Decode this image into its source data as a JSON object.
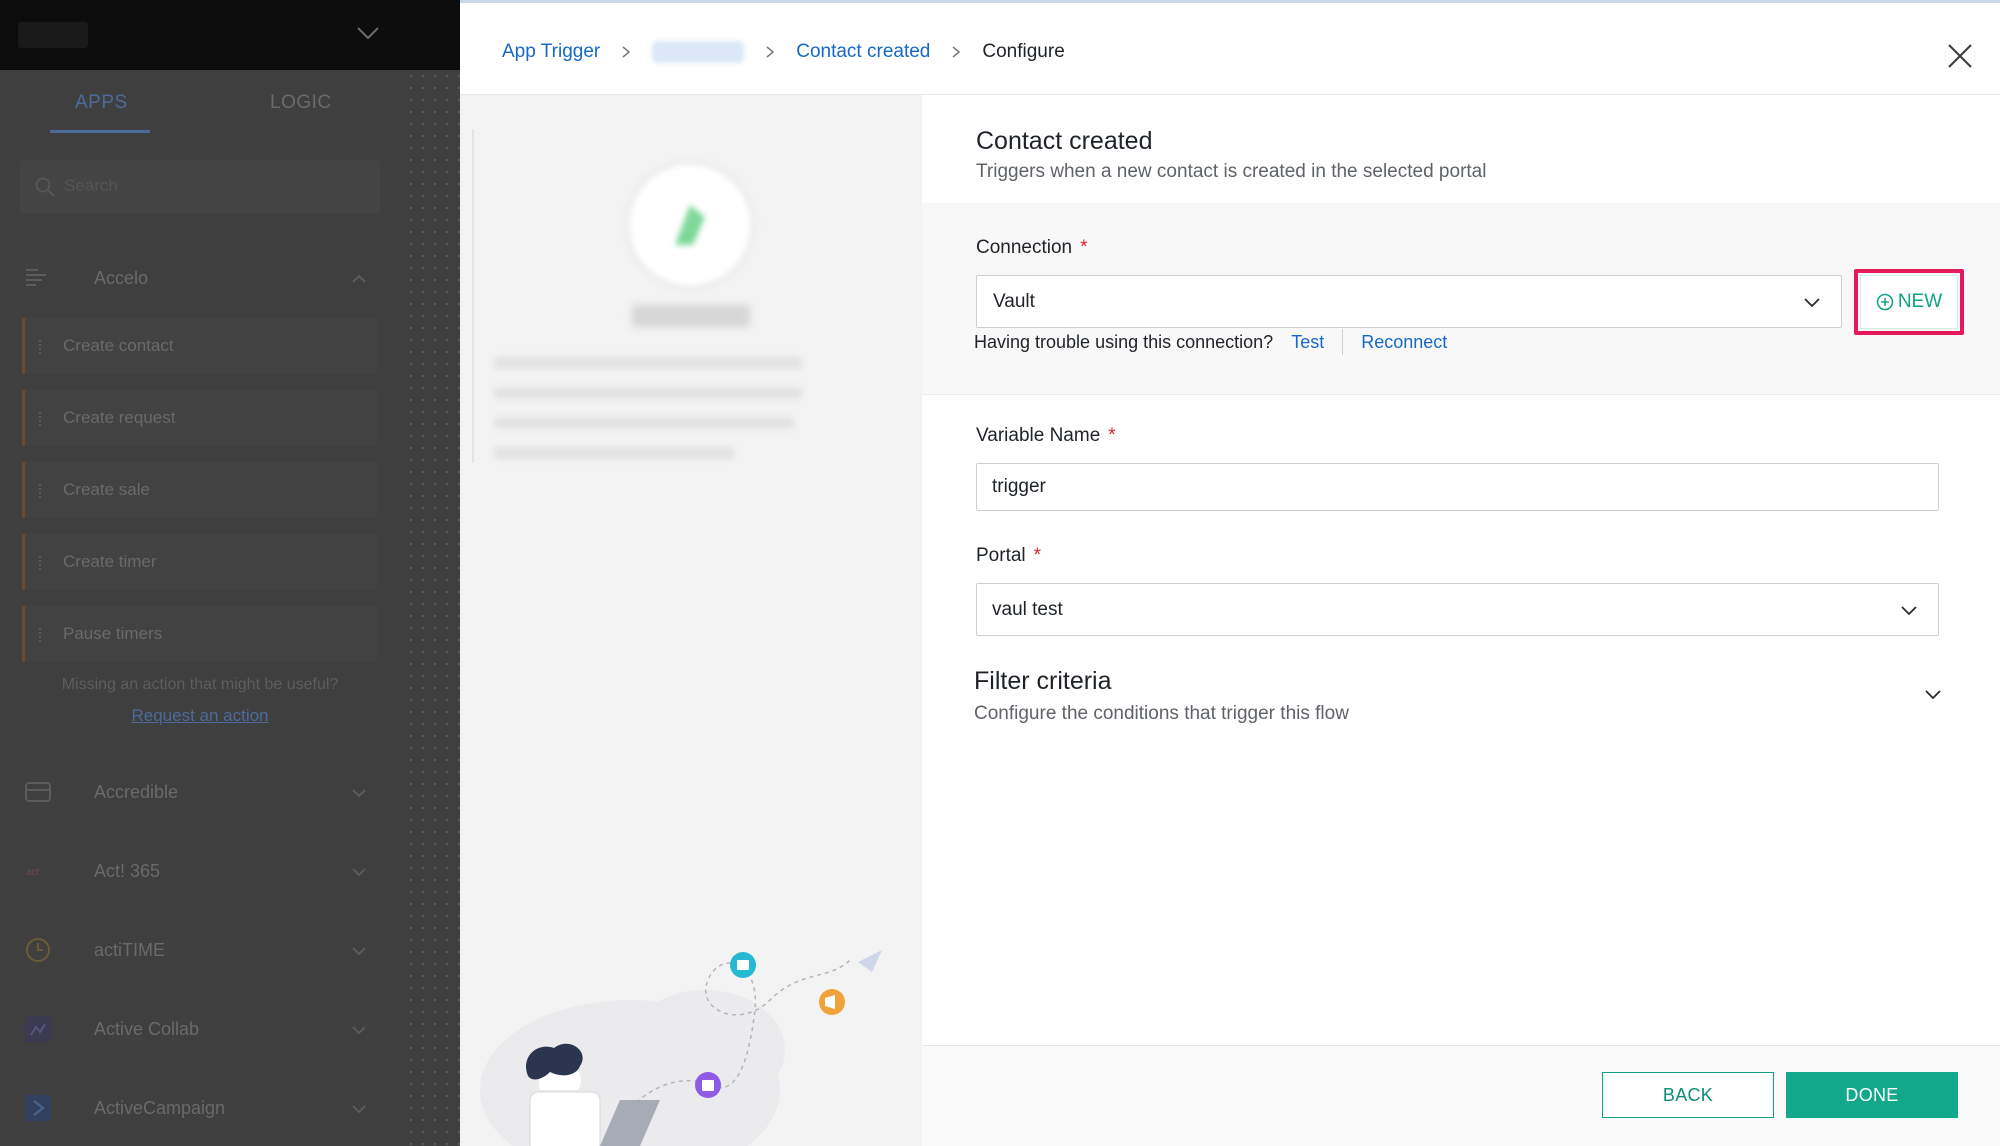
{
  "background_sidebar": {
    "tabs": [
      "APPS",
      "LOGIC"
    ],
    "search_placeholder": "Search",
    "expanded_app": "Accelo",
    "actions": [
      "Create contact",
      "Create request",
      "Create sale",
      "Create timer",
      "Pause timers"
    ],
    "missing_text": "Missing an action that might be useful?",
    "request_link": "Request an action",
    "apps": [
      "Accredible",
      "Act! 365",
      "actiTIME",
      "Active Collab",
      "ActiveCampaign"
    ]
  },
  "breadcrumb": {
    "items": [
      "App Trigger",
      "",
      "Contact created"
    ],
    "current": "Configure"
  },
  "trigger": {
    "title": "Contact created",
    "description": "Triggers when a new contact is created in the selected portal"
  },
  "connection": {
    "label": "Connection",
    "required_mark": "*",
    "value": "Vault",
    "new_button": "NEW",
    "trouble_text": "Having trouble using this connection?",
    "test_link": "Test",
    "reconnect_link": "Reconnect"
  },
  "variable_name": {
    "label": "Variable Name",
    "required_mark": "*",
    "value": "trigger"
  },
  "portal": {
    "label": "Portal",
    "required_mark": "*",
    "value": "vaul test"
  },
  "filter": {
    "title": "Filter criteria",
    "description": "Configure the conditions that trigger this flow"
  },
  "footer": {
    "back": "BACK",
    "done": "DONE"
  },
  "colors": {
    "link": "#1668c8",
    "accent": "#12a88a",
    "required": "#e0222f",
    "highlight": "#e6195a",
    "overlay": "#3f3f3f"
  },
  "icons": [
    "chevron-down-icon",
    "chevron-right-icon",
    "close-icon",
    "plus-circle-icon",
    "search-icon"
  ]
}
